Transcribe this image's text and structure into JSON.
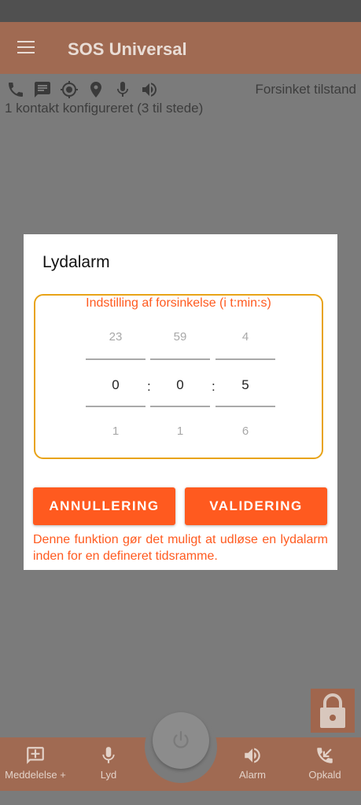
{
  "app": {
    "title": "SOS Universal"
  },
  "status": {
    "mode_text": "Forsinket tilstand",
    "contacts_text": "1 kontakt konfigureret (3 til stede)",
    "icons": [
      "phone-icon",
      "message-icon",
      "gps-target-icon",
      "location-pin-icon",
      "microphone-icon",
      "speaker-icon"
    ]
  },
  "dialog": {
    "title": "Lydalarm",
    "picker_caption": "Indstilling af forsinkelse (i t:min:s)",
    "hours": {
      "prev": "23",
      "current": "0",
      "next": "1"
    },
    "minutes": {
      "prev": "59",
      "current": "0",
      "next": "1"
    },
    "seconds": {
      "prev": "4",
      "current": "5",
      "next": "6"
    },
    "separator": ":",
    "cancel_label": "ANNULLERING",
    "ok_label": "VALIDERING",
    "description": "Denne funktion gør det muligt at udløse en lydalarm inden for en defineret tidsramme."
  },
  "bottom_nav": {
    "message_label": "Meddelelse +",
    "sound_label": "Lyd",
    "alarm_label": "Alarm",
    "call_label": "Opkald"
  },
  "colors": {
    "accent": "#ff5a1f",
    "picker_border": "#e8a317",
    "app_bar_dimmed": "#a06a52",
    "scrim": "#7b7b7b"
  }
}
